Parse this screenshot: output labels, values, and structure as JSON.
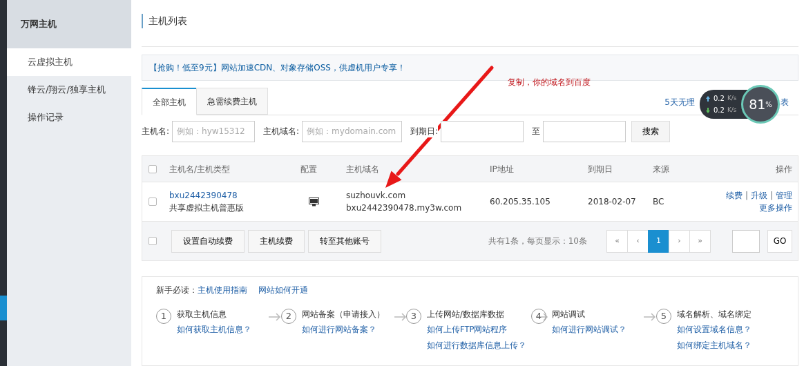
{
  "sidebar": {
    "title": "万网主机",
    "items": [
      {
        "label": "云虚拟主机",
        "selected": true
      },
      {
        "label": "锋云/翔云/独享主机",
        "selected": false
      },
      {
        "label": "操作记录",
        "selected": false
      }
    ]
  },
  "page_title": "主机列表",
  "banner": {
    "highlight": "【抢购！低至9元】",
    "text": "网站加速CDN、对象存储OSS，供虚机用户专享！"
  },
  "annotation": "复制，你的域名到百度",
  "tabs": [
    {
      "label": "全部主机",
      "selected": true
    },
    {
      "label": "急需续费主机",
      "selected": false
    }
  ],
  "side_link": {
    "start": "5天无理",
    "end": "表"
  },
  "speed_widget": {
    "upload": "0.2",
    "upload_unit": "K/s",
    "download": "0.2",
    "download_unit": "K/s",
    "percent": "81",
    "percent_sign": "%"
  },
  "filters": [
    {
      "label": "主机名:",
      "placeholder": "例如：hyw15312"
    },
    {
      "label": "主机域名:",
      "placeholder": "例如：mydomain.com"
    },
    {
      "label": "到期日:"
    },
    {
      "label": "至"
    }
  ],
  "search_button": "搜索",
  "table": {
    "columns": [
      "主机名/主机类型",
      "配置",
      "主机域名",
      "IP地址",
      "到期日",
      "来源",
      "操作"
    ],
    "rows": [
      {
        "checked": false,
        "name": "bxu2442390478",
        "type": "共享虚拟主机普惠版",
        "domains": [
          "suzhouvk.com",
          "bxu2442390478.my3w.com"
        ],
        "ip": "60.205.35.105",
        "expiry": "2018-02-07",
        "source": "BC",
        "actions": [
          "续费",
          "升级",
          "管理"
        ],
        "separators": [
          "|",
          "|"
        ],
        "more": "更多操作"
      }
    ],
    "header_checked": false,
    "footer_checked": false,
    "footer_buttons": [
      "设置自动续费",
      "主机续费",
      "转至其他账号"
    ],
    "summary": "共有1条，每页显示：10条",
    "pages": [
      {
        "label": "«",
        "selected": false
      },
      {
        "label": "‹",
        "selected": false
      },
      {
        "label": "1",
        "selected": true
      },
      {
        "label": "›",
        "selected": false
      },
      {
        "label": "»",
        "selected": false
      }
    ],
    "go_button": "GO"
  },
  "guide": {
    "prefix": "新手必读：",
    "links": [
      "主机使用指南",
      "网站如何开通"
    ],
    "steps": [
      {
        "number": "1",
        "title": "获取主机信息",
        "links": [
          "如何获取主机信息？"
        ]
      },
      {
        "number": "2",
        "title": "网站备案（申请接入）",
        "links": [
          "如何进行网站备案？"
        ]
      },
      {
        "number": "3",
        "title": "上传网站/数据库数据",
        "links": [
          "如何上传FTP网站程序",
          "如何进行数据库信息上传？"
        ]
      },
      {
        "number": "4",
        "title": "网站调试",
        "links": [
          "如何进行网站调试？"
        ]
      },
      {
        "number": "5",
        "title": "域名解析、域名绑定",
        "links": [
          "如何设置域名信息？",
          "如何绑定主机域名？"
        ]
      }
    ]
  }
}
